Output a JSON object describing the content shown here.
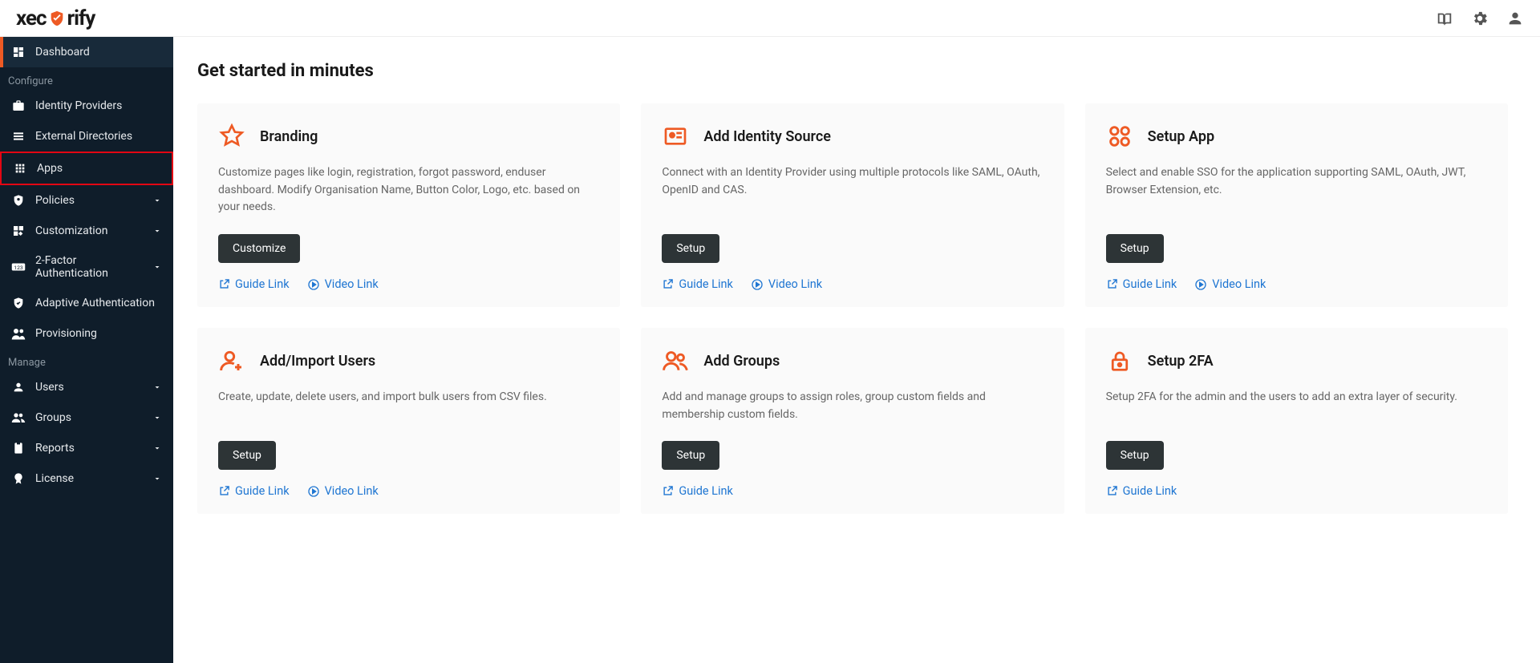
{
  "brand": {
    "part1": "xec",
    "part2": "rify"
  },
  "page": {
    "title": "Get started in minutes"
  },
  "sidebar": {
    "items": [
      {
        "label": "Dashboard",
        "icon": "dashboard",
        "active": true
      },
      {
        "label": "Identity Providers",
        "icon": "identity"
      },
      {
        "label": "External Directories",
        "icon": "directories"
      },
      {
        "label": "Apps",
        "icon": "apps",
        "highlight": true
      },
      {
        "label": "Policies",
        "icon": "policies",
        "expandable": true
      },
      {
        "label": "Customization",
        "icon": "customization",
        "expandable": true
      },
      {
        "label": "2-Factor Authentication",
        "icon": "2fa",
        "expandable": true
      },
      {
        "label": "Adaptive Authentication",
        "icon": "adaptive"
      },
      {
        "label": "Provisioning",
        "icon": "provisioning"
      },
      {
        "label": "Users",
        "icon": "users",
        "expandable": true
      },
      {
        "label": "Groups",
        "icon": "groups",
        "expandable": true
      },
      {
        "label": "Reports",
        "icon": "reports",
        "expandable": true
      },
      {
        "label": "License",
        "icon": "license",
        "expandable": true
      }
    ],
    "sections": {
      "configure": "Configure",
      "manage": "Manage"
    }
  },
  "cards": [
    {
      "title": "Branding",
      "desc": "Customize pages like login, registration, forgot password, enduser dashboard. Modify Organisation Name, Button Color, Logo, etc. based on your needs.",
      "button": "Customize",
      "guide": "Guide Link",
      "video": "Video Link"
    },
    {
      "title": "Add Identity Source",
      "desc": "Connect with an Identity Provider using multiple protocols like SAML, OAuth, OpenID and CAS.",
      "button": "Setup",
      "guide": "Guide Link",
      "video": "Video Link"
    },
    {
      "title": "Setup App",
      "desc": "Select and enable SSO for the application supporting SAML, OAuth, JWT, Browser Extension, etc.",
      "button": "Setup",
      "guide": "Guide Link",
      "video": "Video Link"
    },
    {
      "title": "Add/Import Users",
      "desc": "Create, update, delete users, and import bulk users from CSV files.",
      "button": "Setup",
      "guide": "Guide Link",
      "video": "Video Link"
    },
    {
      "title": "Add Groups",
      "desc": "Add and manage groups to assign roles, group custom fields and membership custom fields.",
      "button": "Setup",
      "guide": "Guide Link"
    },
    {
      "title": "Setup 2FA",
      "desc": "Setup 2FA for the admin and the users to add an extra layer of security.",
      "button": "Setup",
      "guide": "Guide Link"
    }
  ]
}
